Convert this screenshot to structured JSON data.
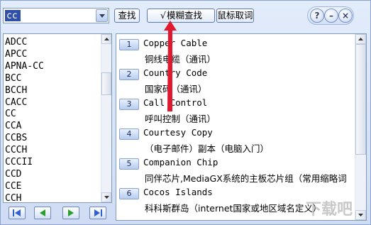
{
  "search": {
    "value": "cc"
  },
  "toolbar": {
    "find_label": "查找",
    "fuzzy_check": "√",
    "fuzzy_label": "模糊查找",
    "mouse_label": "鼠标取词"
  },
  "window_controls": {
    "help": "?",
    "minimize": "–",
    "close": "×"
  },
  "word_list": [
    "ADCC",
    "APCC",
    "APNA-CC",
    "BCC",
    "BCCH",
    "CACC",
    "CC",
    "CCA",
    "CCBS",
    "CCCH",
    "CCCII",
    "CCD",
    "CCE",
    "CCH"
  ],
  "results": [
    {
      "num": "1",
      "term": "Copper Cable",
      "definition": "铜线电缆（通讯）"
    },
    {
      "num": "2",
      "term": "Country Code",
      "definition": "国家码（通讯）"
    },
    {
      "num": "3",
      "term": "Call Control",
      "definition": "呼叫控制（通讯）"
    },
    {
      "num": "4",
      "term": "Courtesy Copy",
      "definition": "（电子邮件）副本（电脑入门）"
    },
    {
      "num": "5",
      "term": "Companion Chip",
      "definition": "同伴芯片,MediaGX系统的主板芯片组（常用缩略词"
    },
    {
      "num": "6",
      "term": "Cocos Islands",
      "definition": "科科斯群岛（internet国家或地区域名定义）"
    }
  ],
  "nav": {
    "first": "first-icon",
    "prev": "prev-icon",
    "next": "next-icon",
    "last": "last-icon"
  },
  "colors": {
    "accent": "#2f4fa8",
    "annotation_arrow": "#e0192e",
    "nav_green": "#2aa12a",
    "nav_blue": "#2f5fd0"
  },
  "watermark": "下载吧"
}
